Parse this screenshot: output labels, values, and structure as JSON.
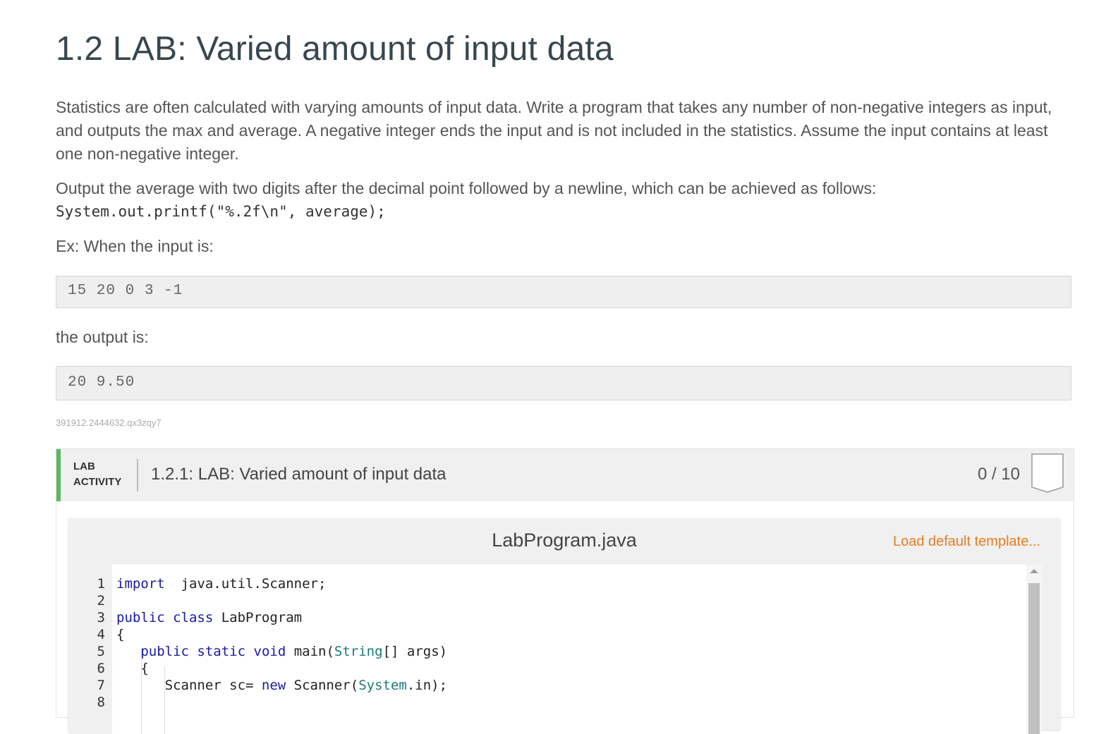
{
  "title": "1.2 LAB: Varied amount of input data",
  "paragraph1": "Statistics are often calculated with varying amounts of input data. Write a program that takes any number of non-negative integers as input, and outputs the max and average. A negative integer ends the input and is not included in the statistics. Assume the input contains at least one non-negative integer.",
  "paragraph2": "Output the average with two digits after the decimal point followed by a newline, which can be achieved as follows:",
  "printf_code": "System.out.printf(\"%.2f\\n\", average);",
  "example_intro": "Ex: When the input is:",
  "example_input": "15 20 0 3 -1",
  "output_intro": "the output is:",
  "example_output": "20 9.50",
  "reference_id": "391912.2444632.qx3zqy7",
  "lab": {
    "tag_line1": "LAB",
    "tag_line2": "ACTIVITY",
    "title": "1.2.1: LAB: Varied amount of input data",
    "score": "0 / 10",
    "accent_color": "#5cb85c"
  },
  "editor": {
    "filename": "LabProgram.java",
    "load_template": "Load default template...",
    "lines": [
      {
        "n": "1",
        "tokens": [
          [
            "kw",
            "import"
          ],
          [
            "",
            "  java.util.Scanner;"
          ]
        ]
      },
      {
        "n": "2",
        "tokens": []
      },
      {
        "n": "3",
        "tokens": [
          [
            "kw",
            "public"
          ],
          [
            "",
            " "
          ],
          [
            "kw",
            "class"
          ],
          [
            "",
            " LabProgram"
          ]
        ]
      },
      {
        "n": "4",
        "tokens": [
          [
            "",
            "{"
          ]
        ]
      },
      {
        "n": "5",
        "tokens": [
          [
            "",
            "   "
          ],
          [
            "kw",
            "public"
          ],
          [
            "",
            " "
          ],
          [
            "kw",
            "static"
          ],
          [
            "",
            " "
          ],
          [
            "kw",
            "void"
          ],
          [
            "",
            " main("
          ],
          [
            "ty",
            "String"
          ],
          [
            "",
            "[] args)"
          ]
        ]
      },
      {
        "n": "6",
        "tokens": [
          [
            "",
            "   {"
          ]
        ]
      },
      {
        "n": "7",
        "tokens": [
          [
            "",
            "      Scanner sc= "
          ],
          [
            "kw",
            "new"
          ],
          [
            "",
            " Scanner("
          ],
          [
            "ty",
            "System"
          ],
          [
            "",
            ".in);"
          ]
        ]
      },
      {
        "n": "8",
        "tokens": []
      }
    ]
  }
}
